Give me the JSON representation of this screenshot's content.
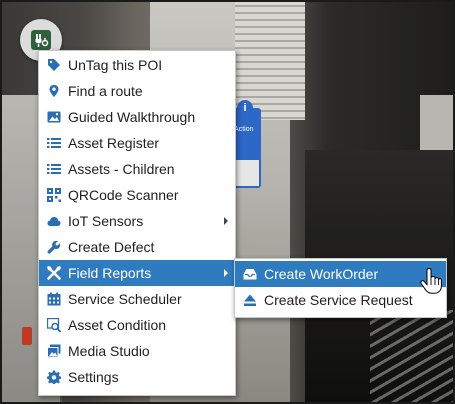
{
  "colors": {
    "accent": "#2e7bbf",
    "icon_blue": "#2a6db0",
    "menu_bg": "#ffffff",
    "text": "#1f1f1f"
  },
  "app_button": {
    "icon": "asset-plug-icon"
  },
  "menu": {
    "items": [
      {
        "label": "UnTag this POI",
        "icon": "tag-icon"
      },
      {
        "label": "Find a route",
        "icon": "map-marker-icon"
      },
      {
        "label": "Guided Walkthrough",
        "icon": "image-icon"
      },
      {
        "label": "Asset Register",
        "icon": "list-icon"
      },
      {
        "label": "Assets - Children",
        "icon": "list-icon"
      },
      {
        "label": "QRCode Scanner",
        "icon": "qrcode-icon"
      },
      {
        "label": "IoT Sensors",
        "icon": "cloud-icon"
      },
      {
        "label": "Create Defect",
        "icon": "wrench-icon"
      },
      {
        "label": "Field Reports",
        "icon": "tools-icon"
      },
      {
        "label": "Service Scheduler",
        "icon": "calendar-icon"
      },
      {
        "label": "Asset Condition",
        "icon": "search-image-icon"
      },
      {
        "label": "Media Studio",
        "icon": "images-icon"
      },
      {
        "label": "Settings",
        "icon": "gear-icon"
      }
    ]
  },
  "submenu": {
    "items": [
      {
        "label": "Create WorkOrder",
        "icon": "inbox-tray-icon"
      },
      {
        "label": "Create Service Request",
        "icon": "eject-icon"
      }
    ]
  },
  "background": {
    "sign_label": "y Action"
  }
}
